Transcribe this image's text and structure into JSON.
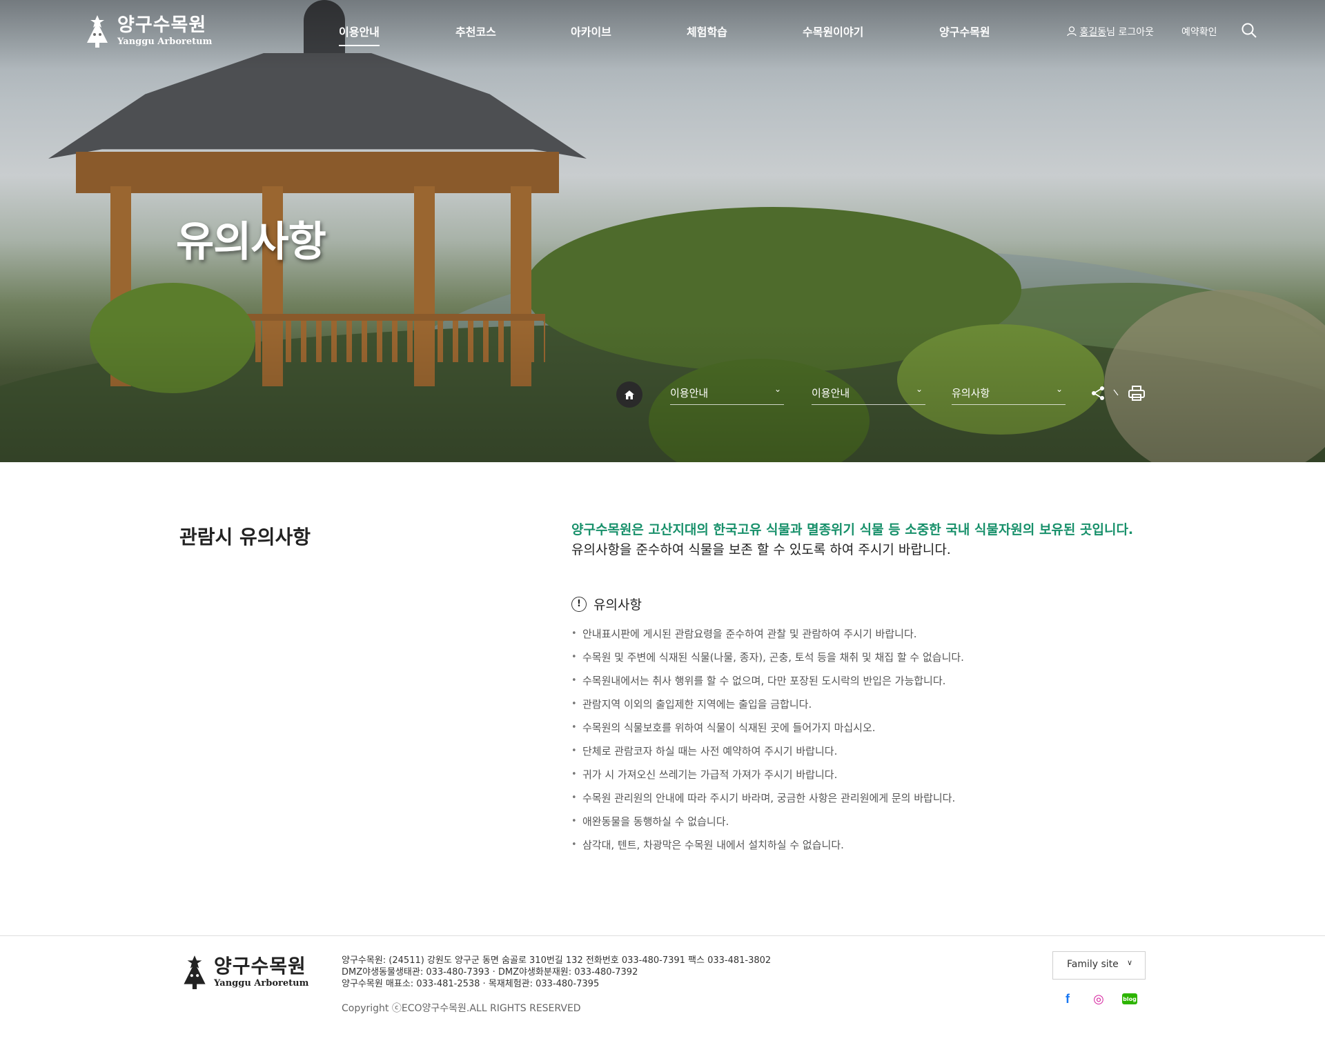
{
  "header": {
    "logo_ko": "양구수목원",
    "logo_en": "Yanggu Arboretum",
    "nav": [
      "이용안내",
      "추천코스",
      "아카이브",
      "체험학습",
      "수목원이야기",
      "양구수목원"
    ],
    "user_name": "홍길동",
    "user_suffix": "님",
    "logout": "로그아웃",
    "reservation": "예약확인"
  },
  "hero": {
    "title": "유의사항"
  },
  "location": {
    "depth1": "이용안내",
    "depth2": "이용안내",
    "depth3": "유의사항"
  },
  "content": {
    "section_title": "관람시 유의사항",
    "lead_green": "양구수목원은 고산지대의 한국고유 식물과 멸종위기 식물 등 소중한 국내 식물자원의 보유된 곳입니다.",
    "lead_black": "유의사항을 준수하여 식물을 보존 할 수 있도록 하여 주시기 바랍니다.",
    "notice_heading": "유의사항",
    "notices": [
      "안내표시판에 게시된 관람요령을 준수하여 관찰 및 관람하여 주시기 바랍니다.",
      "수목원 및 주변에 식재된 식물(나물, 종자), 곤충, 토석 등을 채취 및 채집 할 수 없습니다.",
      "수목원내에서는 취사 행위를 할 수 없으며, 다만 포장된 도시락의 반입은 가능합니다.",
      "관람지역 이외의 출입제한 지역에는 출입을 금합니다.",
      "수목원의 식물보호를 위하여 식물이 식재된 곳에 들어가지 마십시오.",
      "단체로 관람코자 하실 때는 사전 예약하여 주시기 바랍니다.",
      "귀가 시 가져오신 쓰레기는 가급적 가져가 주시기 바랍니다.",
      "수목원 관리원의 안내에 따라 주시기 바라며, 궁금한 사항은 관리원에게 문의 바랍니다.",
      "애완동물을 동행하실 수 없습니다.",
      "삼각대, 텐트, 차광막은 수목원 내에서 설치하실 수 없습니다."
    ]
  },
  "footer": {
    "logo_ko": "양구수목원",
    "logo_en": "Yanggu Arboretum",
    "info_lines": [
      "양구수목원: (24511) 강원도 양구군 동면 숨골로 310번길 132 전화번호 033-480-7391 팩스 033-481-3802",
      "DMZ야생동물생태관: 033-480-7393 · DMZ야생화분재원: 033-480-7392",
      "양구수목원 매표소: 033-481-2538 · 목재체험관: 033-480-7395"
    ],
    "copyright": "Copyright ⓒECO양구수목원.ALL RIGHTS RESERVED",
    "family_site": "Family site",
    "sns": [
      {
        "icon": "facebook-icon",
        "glyph": "f",
        "color": "#1877f2"
      },
      {
        "icon": "instagram-icon",
        "glyph": "◎",
        "color": "#d6249f"
      },
      {
        "icon": "blog-icon",
        "glyph": "blog",
        "color": "#2db400"
      }
    ]
  },
  "colors": {
    "accent_green": "#17906a",
    "text": "#222222",
    "home_button": "#2a2a2a"
  }
}
